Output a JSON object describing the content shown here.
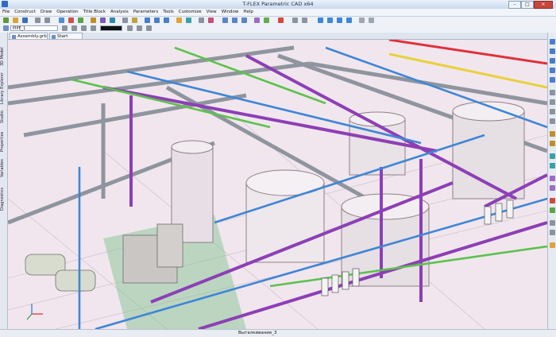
{
  "window": {
    "title": "T-FLEX Parametric CAD x64",
    "minimize": "–",
    "maximize": "□",
    "close": "×"
  },
  "menu": [
    "File",
    "Construct",
    "Draw",
    "Operation",
    "Title Block",
    "Analysis",
    "Parameters",
    "Tools",
    "Customize",
    "View",
    "Window",
    "Help"
  ],
  "toolbar": {
    "layer_field": "PIPE_1"
  },
  "tabs": [
    {
      "label": "Assembly.grb"
    },
    {
      "label": "Start Page"
    }
  ],
  "left_panel": {
    "tabs": [
      "3D Model",
      "Library Explorer",
      "Studio",
      "Properties",
      "Variables",
      "Diagnostics"
    ]
  },
  "status": {
    "text": "Выталкивание_3"
  },
  "colors": {
    "violet_pipe": "#8d3fb5",
    "blue_pipe": "#3f86d6",
    "green_pipe": "#5cc24d",
    "grey_frame": "#9aa0a8",
    "red_pipe": "#e0303a",
    "yellow_pipe": "#e7d23a"
  }
}
